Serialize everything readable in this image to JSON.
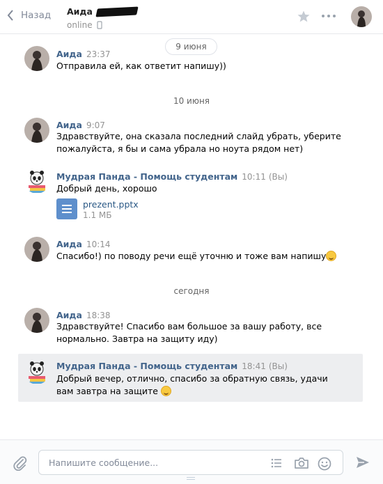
{
  "header": {
    "back_label": "Назад",
    "peer_name": "Аида",
    "peer_status": "online"
  },
  "dates": [
    "9 июня",
    "10 июня",
    "сегодня"
  ],
  "messages": [
    {
      "author": "Аида",
      "time": "23:37",
      "text": "Отправила ей, как ответит напишу))"
    },
    {
      "author": "Аида",
      "time": "9:07",
      "text": "Здравствуйте, она сказала последний слайд убрать, уберите пожалуйста, я бы и сама убрала но ноута рядом нет)"
    },
    {
      "author": "Мудрая Панда - Помощь студентам",
      "time": "10:11",
      "you": "(Вы)",
      "text": "Добрый день, хорошо",
      "file": {
        "name": "prezent.pptx",
        "size": "1.1 МБ"
      }
    },
    {
      "author": "Аида",
      "time": "10:14",
      "text": "Спасибо!) по поводу речи ещё уточню и тоже вам напишу"
    },
    {
      "author": "Аида",
      "time": "18:38",
      "text": "Здравствуйте! Спасибо вам большое за вашу работу, все нормально. Завтра на защиту иду)"
    },
    {
      "author": "Мудрая Панда - Помощь студентам",
      "time": "18:41",
      "you": "(Вы)",
      "text": "Добрый вечер, отлично, спасибо за обратную связь, удачи вам завтра на защите"
    }
  ],
  "composer": {
    "placeholder": "Напишите сообщение..."
  },
  "colors": {
    "author": "#42648b",
    "file_icon": "#5e8fcc",
    "highlight": "#edeef0"
  }
}
